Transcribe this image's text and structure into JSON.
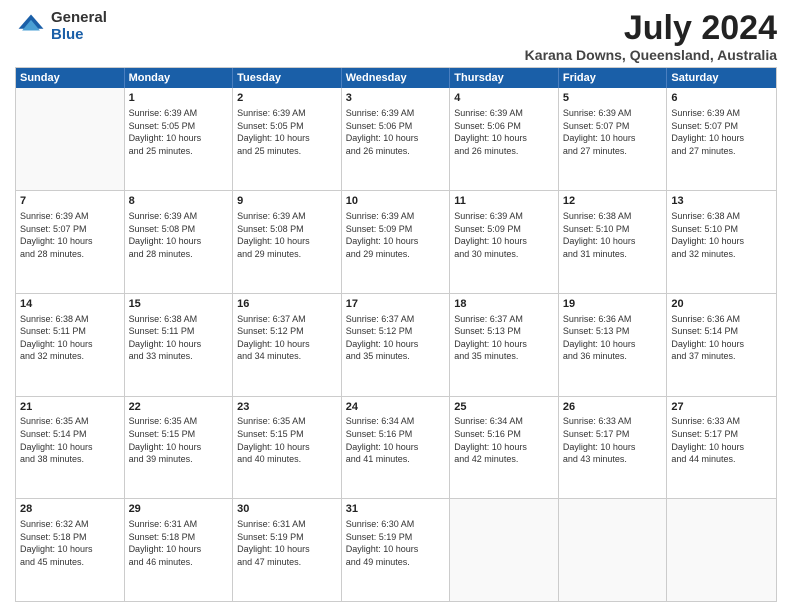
{
  "logo": {
    "general": "General",
    "blue": "Blue"
  },
  "title": "July 2024",
  "location": "Karana Downs, Queensland, Australia",
  "days_of_week": [
    "Sunday",
    "Monday",
    "Tuesday",
    "Wednesday",
    "Thursday",
    "Friday",
    "Saturday"
  ],
  "weeks": [
    [
      {
        "day": "",
        "content": ""
      },
      {
        "day": "1",
        "content": "Sunrise: 6:39 AM\nSunset: 5:05 PM\nDaylight: 10 hours\nand 25 minutes."
      },
      {
        "day": "2",
        "content": "Sunrise: 6:39 AM\nSunset: 5:05 PM\nDaylight: 10 hours\nand 25 minutes."
      },
      {
        "day": "3",
        "content": "Sunrise: 6:39 AM\nSunset: 5:06 PM\nDaylight: 10 hours\nand 26 minutes."
      },
      {
        "day": "4",
        "content": "Sunrise: 6:39 AM\nSunset: 5:06 PM\nDaylight: 10 hours\nand 26 minutes."
      },
      {
        "day": "5",
        "content": "Sunrise: 6:39 AM\nSunset: 5:07 PM\nDaylight: 10 hours\nand 27 minutes."
      },
      {
        "day": "6",
        "content": "Sunrise: 6:39 AM\nSunset: 5:07 PM\nDaylight: 10 hours\nand 27 minutes."
      }
    ],
    [
      {
        "day": "7",
        "content": "Sunrise: 6:39 AM\nSunset: 5:07 PM\nDaylight: 10 hours\nand 28 minutes."
      },
      {
        "day": "8",
        "content": "Sunrise: 6:39 AM\nSunset: 5:08 PM\nDaylight: 10 hours\nand 28 minutes."
      },
      {
        "day": "9",
        "content": "Sunrise: 6:39 AM\nSunset: 5:08 PM\nDaylight: 10 hours\nand 29 minutes."
      },
      {
        "day": "10",
        "content": "Sunrise: 6:39 AM\nSunset: 5:09 PM\nDaylight: 10 hours\nand 29 minutes."
      },
      {
        "day": "11",
        "content": "Sunrise: 6:39 AM\nSunset: 5:09 PM\nDaylight: 10 hours\nand 30 minutes."
      },
      {
        "day": "12",
        "content": "Sunrise: 6:38 AM\nSunset: 5:10 PM\nDaylight: 10 hours\nand 31 minutes."
      },
      {
        "day": "13",
        "content": "Sunrise: 6:38 AM\nSunset: 5:10 PM\nDaylight: 10 hours\nand 32 minutes."
      }
    ],
    [
      {
        "day": "14",
        "content": "Sunrise: 6:38 AM\nSunset: 5:11 PM\nDaylight: 10 hours\nand 32 minutes."
      },
      {
        "day": "15",
        "content": "Sunrise: 6:38 AM\nSunset: 5:11 PM\nDaylight: 10 hours\nand 33 minutes."
      },
      {
        "day": "16",
        "content": "Sunrise: 6:37 AM\nSunset: 5:12 PM\nDaylight: 10 hours\nand 34 minutes."
      },
      {
        "day": "17",
        "content": "Sunrise: 6:37 AM\nSunset: 5:12 PM\nDaylight: 10 hours\nand 35 minutes."
      },
      {
        "day": "18",
        "content": "Sunrise: 6:37 AM\nSunset: 5:13 PM\nDaylight: 10 hours\nand 35 minutes."
      },
      {
        "day": "19",
        "content": "Sunrise: 6:36 AM\nSunset: 5:13 PM\nDaylight: 10 hours\nand 36 minutes."
      },
      {
        "day": "20",
        "content": "Sunrise: 6:36 AM\nSunset: 5:14 PM\nDaylight: 10 hours\nand 37 minutes."
      }
    ],
    [
      {
        "day": "21",
        "content": "Sunrise: 6:35 AM\nSunset: 5:14 PM\nDaylight: 10 hours\nand 38 minutes."
      },
      {
        "day": "22",
        "content": "Sunrise: 6:35 AM\nSunset: 5:15 PM\nDaylight: 10 hours\nand 39 minutes."
      },
      {
        "day": "23",
        "content": "Sunrise: 6:35 AM\nSunset: 5:15 PM\nDaylight: 10 hours\nand 40 minutes."
      },
      {
        "day": "24",
        "content": "Sunrise: 6:34 AM\nSunset: 5:16 PM\nDaylight: 10 hours\nand 41 minutes."
      },
      {
        "day": "25",
        "content": "Sunrise: 6:34 AM\nSunset: 5:16 PM\nDaylight: 10 hours\nand 42 minutes."
      },
      {
        "day": "26",
        "content": "Sunrise: 6:33 AM\nSunset: 5:17 PM\nDaylight: 10 hours\nand 43 minutes."
      },
      {
        "day": "27",
        "content": "Sunrise: 6:33 AM\nSunset: 5:17 PM\nDaylight: 10 hours\nand 44 minutes."
      }
    ],
    [
      {
        "day": "28",
        "content": "Sunrise: 6:32 AM\nSunset: 5:18 PM\nDaylight: 10 hours\nand 45 minutes."
      },
      {
        "day": "29",
        "content": "Sunrise: 6:31 AM\nSunset: 5:18 PM\nDaylight: 10 hours\nand 46 minutes."
      },
      {
        "day": "30",
        "content": "Sunrise: 6:31 AM\nSunset: 5:19 PM\nDaylight: 10 hours\nand 47 minutes."
      },
      {
        "day": "31",
        "content": "Sunrise: 6:30 AM\nSunset: 5:19 PM\nDaylight: 10 hours\nand 49 minutes."
      },
      {
        "day": "",
        "content": ""
      },
      {
        "day": "",
        "content": ""
      },
      {
        "day": "",
        "content": ""
      }
    ]
  ]
}
